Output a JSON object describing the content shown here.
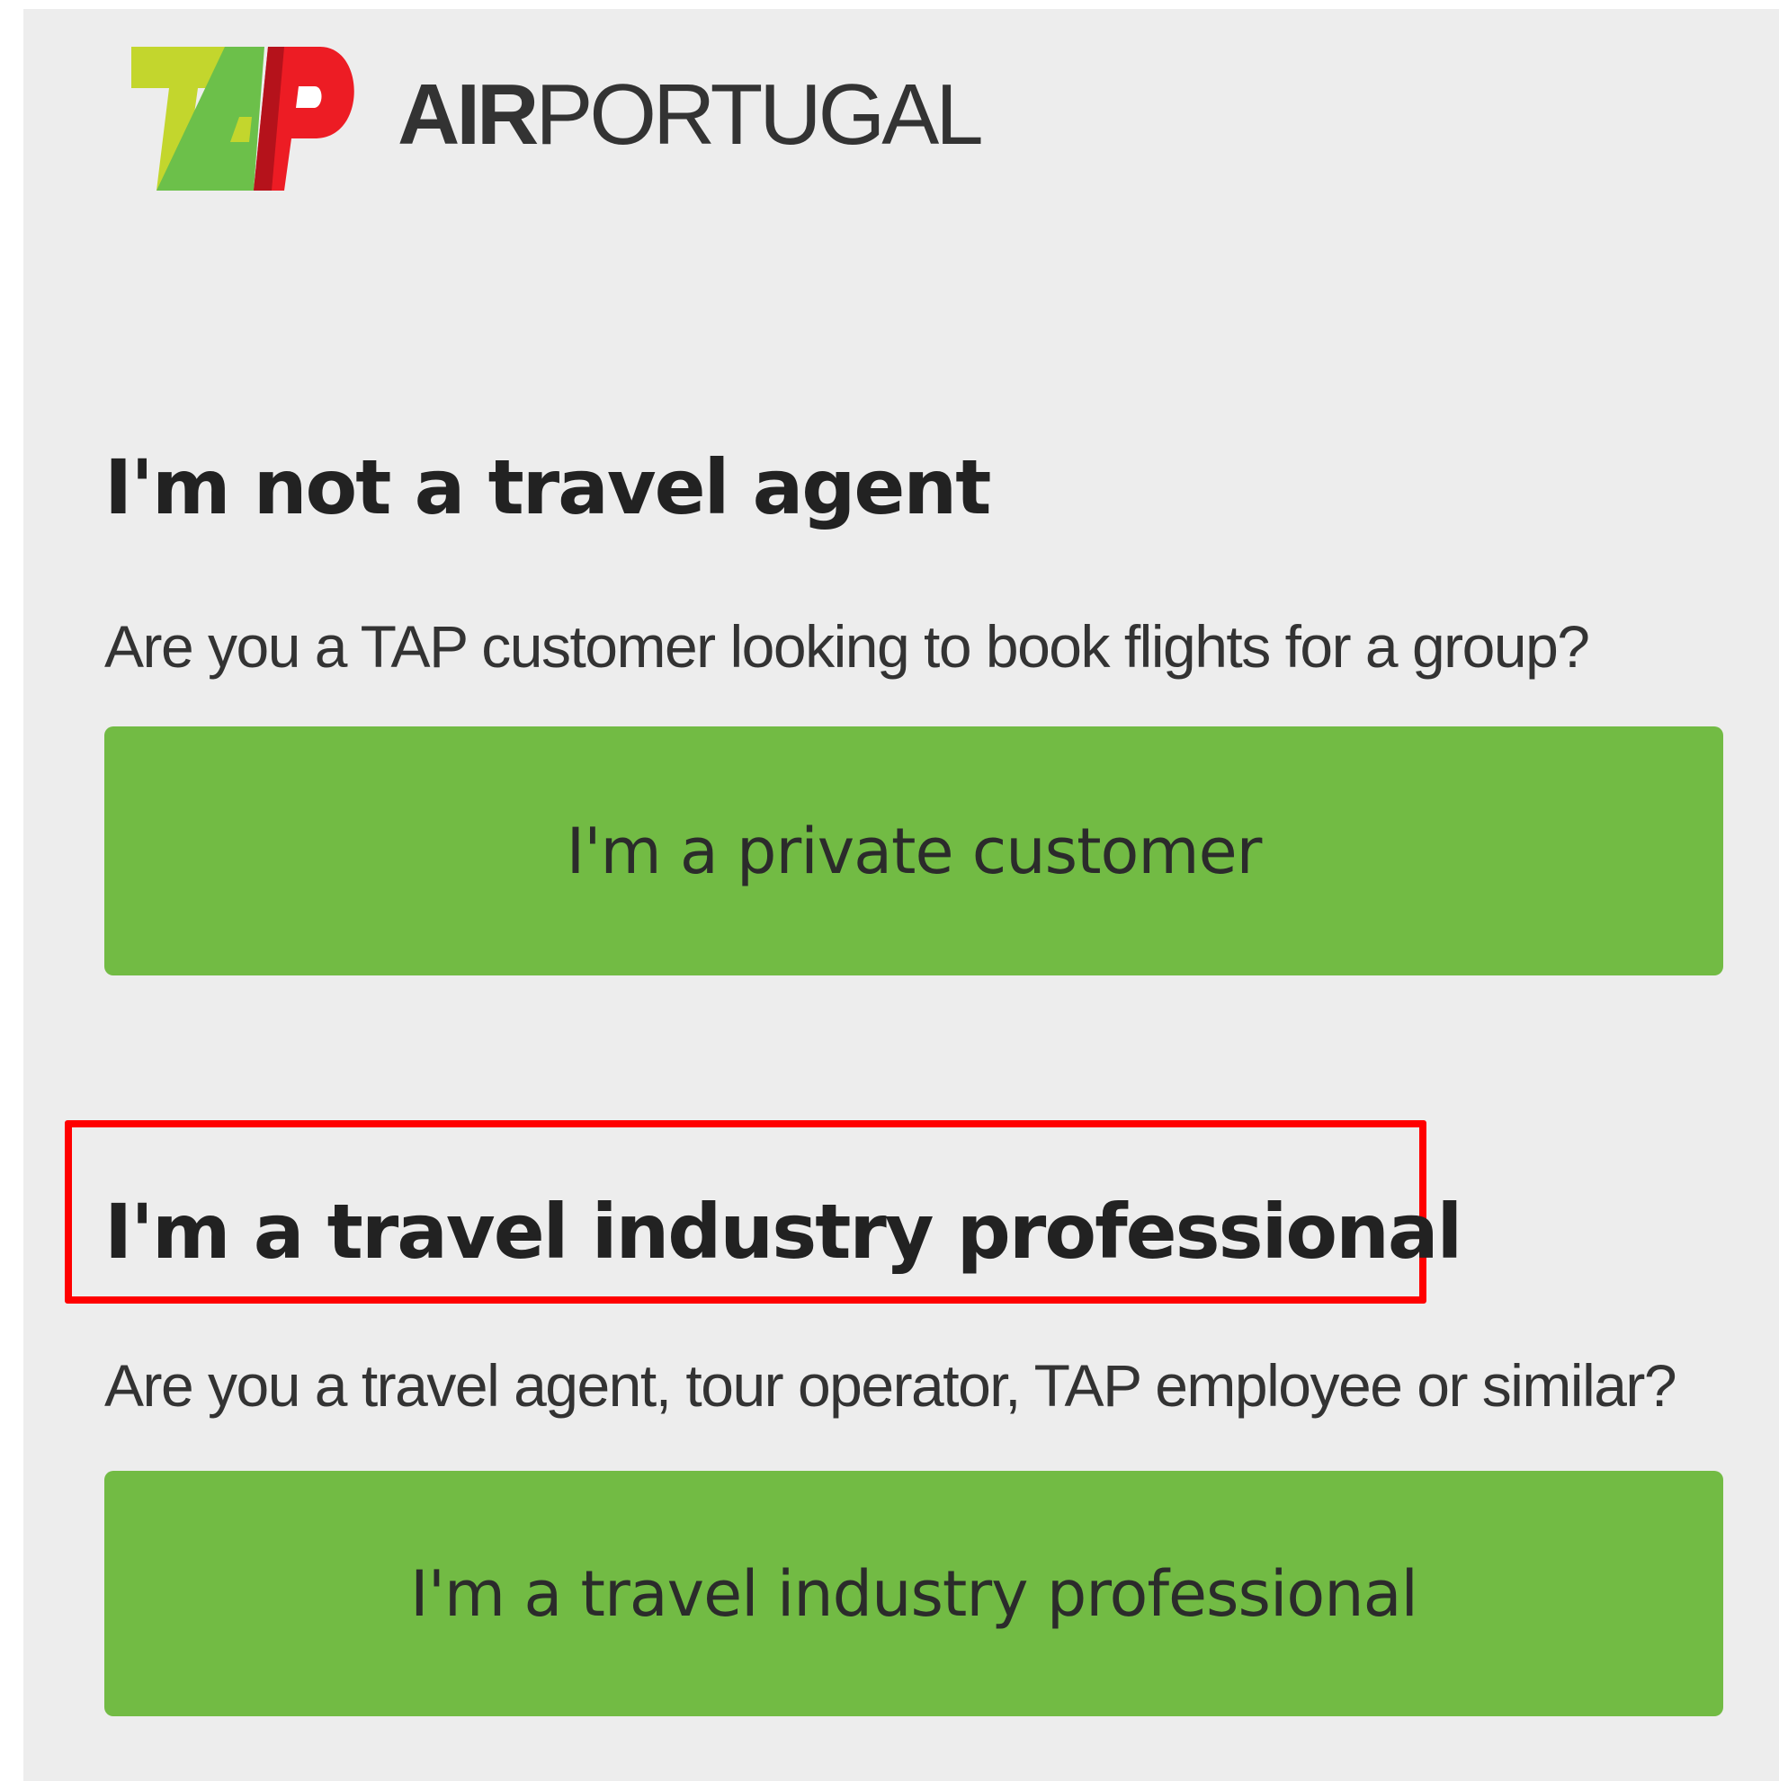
{
  "header": {
    "logo_mark": "TAP",
    "brand_strong": "AIR",
    "brand_light": "PORTUGAL"
  },
  "sections": [
    {
      "heading": "I'm not a travel agent",
      "description": "Are you a TAP customer looking to book flights for a group?",
      "button_label": "I'm a private customer"
    },
    {
      "heading": "I'm a travel industry professional",
      "description": "Are you a travel agent, tour operator, TAP employee or similar?",
      "button_label": "I'm a travel industry professional"
    }
  ],
  "colors": {
    "page_background": "#ededed",
    "button_green": "#72bb44",
    "logo_lime": "#c3d62d",
    "logo_green": "#6cc04a",
    "logo_red": "#ed1c24",
    "highlight_red": "#ff0000"
  }
}
